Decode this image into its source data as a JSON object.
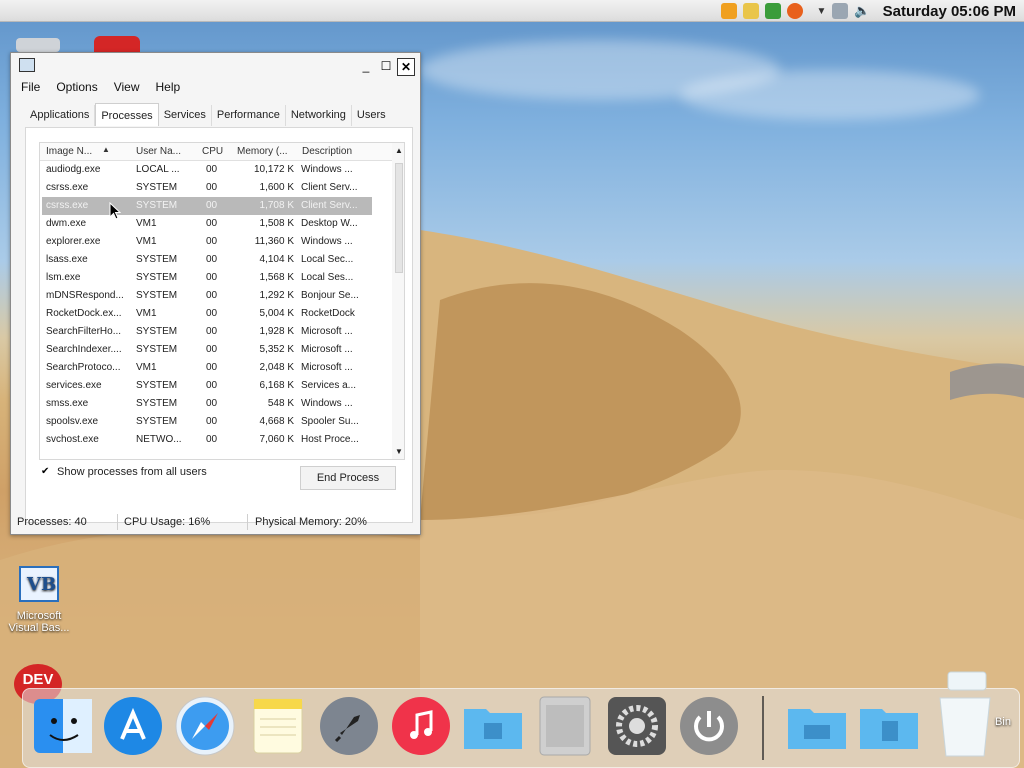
{
  "menubar": {
    "clock": "Saturday 05:06 PM"
  },
  "task_manager": {
    "menu": [
      "File",
      "Options",
      "View",
      "Help"
    ],
    "tabs": [
      "Applications",
      "Processes",
      "Services",
      "Performance",
      "Networking",
      "Users"
    ],
    "active_tab": "Processes",
    "columns": [
      "Image N...",
      "User Na...",
      "CPU",
      "Memory (...",
      "Description"
    ],
    "rows": [
      {
        "image": "audiodg.exe",
        "user": "LOCAL ...",
        "cpu": "00",
        "memory": "10,172 K",
        "desc": "Windows ..."
      },
      {
        "image": "csrss.exe",
        "user": "SYSTEM",
        "cpu": "00",
        "memory": "1,600 K",
        "desc": "Client Serv..."
      },
      {
        "image": "csrss.exe",
        "user": "SYSTEM",
        "cpu": "00",
        "memory": "1,708 K",
        "desc": "Client Serv..."
      },
      {
        "image": "dwm.exe",
        "user": "VM1",
        "cpu": "00",
        "memory": "1,508 K",
        "desc": "Desktop W..."
      },
      {
        "image": "explorer.exe",
        "user": "VM1",
        "cpu": "00",
        "memory": "11,360 K",
        "desc": "Windows ..."
      },
      {
        "image": "lsass.exe",
        "user": "SYSTEM",
        "cpu": "00",
        "memory": "4,104 K",
        "desc": "Local Sec..."
      },
      {
        "image": "lsm.exe",
        "user": "SYSTEM",
        "cpu": "00",
        "memory": "1,568 K",
        "desc": "Local Ses..."
      },
      {
        "image": "mDNSRespond...",
        "user": "SYSTEM",
        "cpu": "00",
        "memory": "1,292 K",
        "desc": "Bonjour Se..."
      },
      {
        "image": "RocketDock.ex...",
        "user": "VM1",
        "cpu": "00",
        "memory": "5,004 K",
        "desc": "RocketDock"
      },
      {
        "image": "SearchFilterHo...",
        "user": "SYSTEM",
        "cpu": "00",
        "memory": "1,928 K",
        "desc": "Microsoft ..."
      },
      {
        "image": "SearchIndexer....",
        "user": "SYSTEM",
        "cpu": "00",
        "memory": "5,352 K",
        "desc": "Microsoft ..."
      },
      {
        "image": "SearchProtoco...",
        "user": "VM1",
        "cpu": "00",
        "memory": "2,048 K",
        "desc": "Microsoft ..."
      },
      {
        "image": "services.exe",
        "user": "SYSTEM",
        "cpu": "00",
        "memory": "6,168 K",
        "desc": "Services a..."
      },
      {
        "image": "smss.exe",
        "user": "SYSTEM",
        "cpu": "00",
        "memory": "548 K",
        "desc": "Windows ..."
      },
      {
        "image": "spoolsv.exe",
        "user": "SYSTEM",
        "cpu": "00",
        "memory": "4,668 K",
        "desc": "Spooler Su..."
      },
      {
        "image": "svchost.exe",
        "user": "NETWO...",
        "cpu": "00",
        "memory": "7,060 K",
        "desc": "Host Proce..."
      }
    ],
    "selected_row": 2,
    "show_all_label": "Show processes from all users",
    "end_process_label": "End Process",
    "status": {
      "processes": "Processes: 40",
      "cpu": "CPU Usage: 16%",
      "memory": "Physical Memory: 20%"
    }
  },
  "desktop": {
    "vb_icon_label": "Microsoft Visual Bas...",
    "dev_badge": "DEV",
    "bin_label": "Bin"
  }
}
